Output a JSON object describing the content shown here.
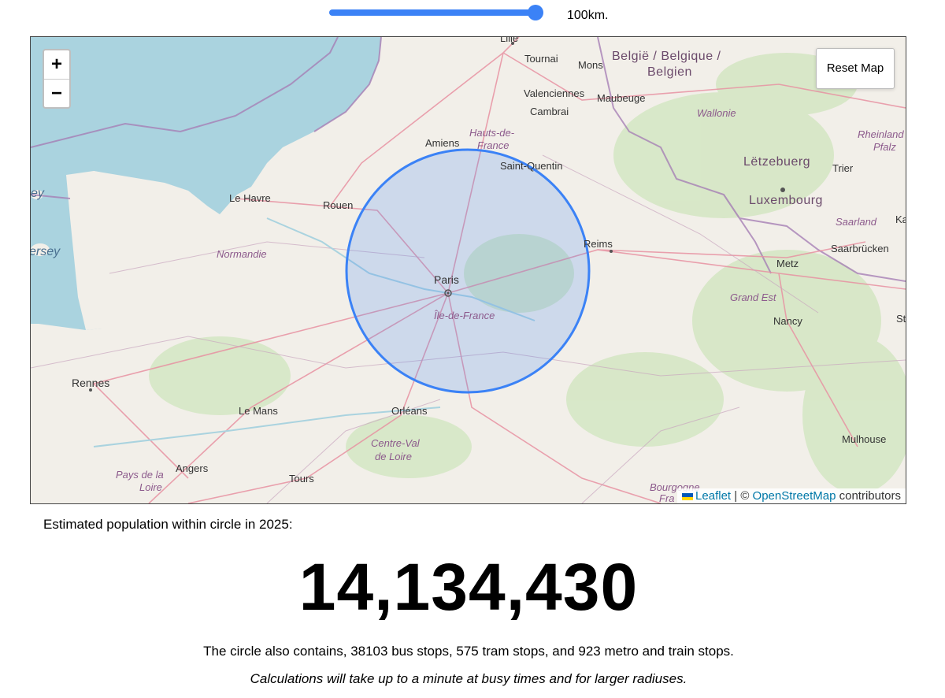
{
  "radius_slider": {
    "value_label": "100km.",
    "fraction": 0.96
  },
  "map": {
    "zoom_in_label": "+",
    "zoom_out_label": "−",
    "reset_label": "Reset Map",
    "attribution": {
      "leaflet": "Leaflet",
      "separator": " | © ",
      "osm": "OpenStreetMap",
      "suffix": " contributors"
    },
    "labels": {
      "lille": "Lille",
      "tournai": "Tournai",
      "mons": "Mons",
      "belgium": "België / Belgique /",
      "belgium2": "Belgien",
      "valenciennes": "Valenciennes",
      "maubeuge": "Maubeuge",
      "cambrai": "Cambrai",
      "wallonie": "Wallonie",
      "hauts": "Hauts-de-",
      "hauts2": "France",
      "amiens": "Amiens",
      "saint_quentin": "Saint-Quentin",
      "rheinland": "Rheinland",
      "pfalz": "Pfalz",
      "letzebuerg": "Lëtzebuerg",
      "trier": "Trier",
      "luxembourg": "Luxembourg",
      "le_havre": "Le Havre",
      "rouen": "Rouen",
      "saarland": "Saarland",
      "saarbrucken": "Saarbrücken",
      "jersey_partial": "ersey",
      "guernsey_partial": "ey",
      "normandie": "Normandie",
      "paris": "Paris",
      "reims": "Reims",
      "metz": "Metz",
      "ile_de_france": "Île-de-France",
      "grand_est": "Grand Est",
      "nancy": "Nancy",
      "st_partial": "St",
      "ka_partial": "Ka",
      "rennes": "Rennes",
      "le_mans": "Le Mans",
      "orleans": "Orléans",
      "centre": "Centre-Val",
      "centre2": "de Loire",
      "mulhouse": "Mulhouse",
      "angers": "Angers",
      "pays": "Pays de la",
      "pays2": "Loire",
      "tours": "Tours",
      "bourgogne": "Bourgogne",
      "fra_partial": "Fra"
    }
  },
  "population_label": "Estimated population within circle in 2025:",
  "population_value": "14,134,430",
  "stops_text": "The circle also contains, 38103 bus stops, 575 tram stops, and 923 metro and train stops.",
  "note_text": "Calculations will take up to a minute at busy times and for larger radiuses.",
  "colors": {
    "accent": "#3b82f6",
    "circle_fill": "#3b82f6",
    "sea": "#aad3df",
    "land": "#f2efe9"
  }
}
